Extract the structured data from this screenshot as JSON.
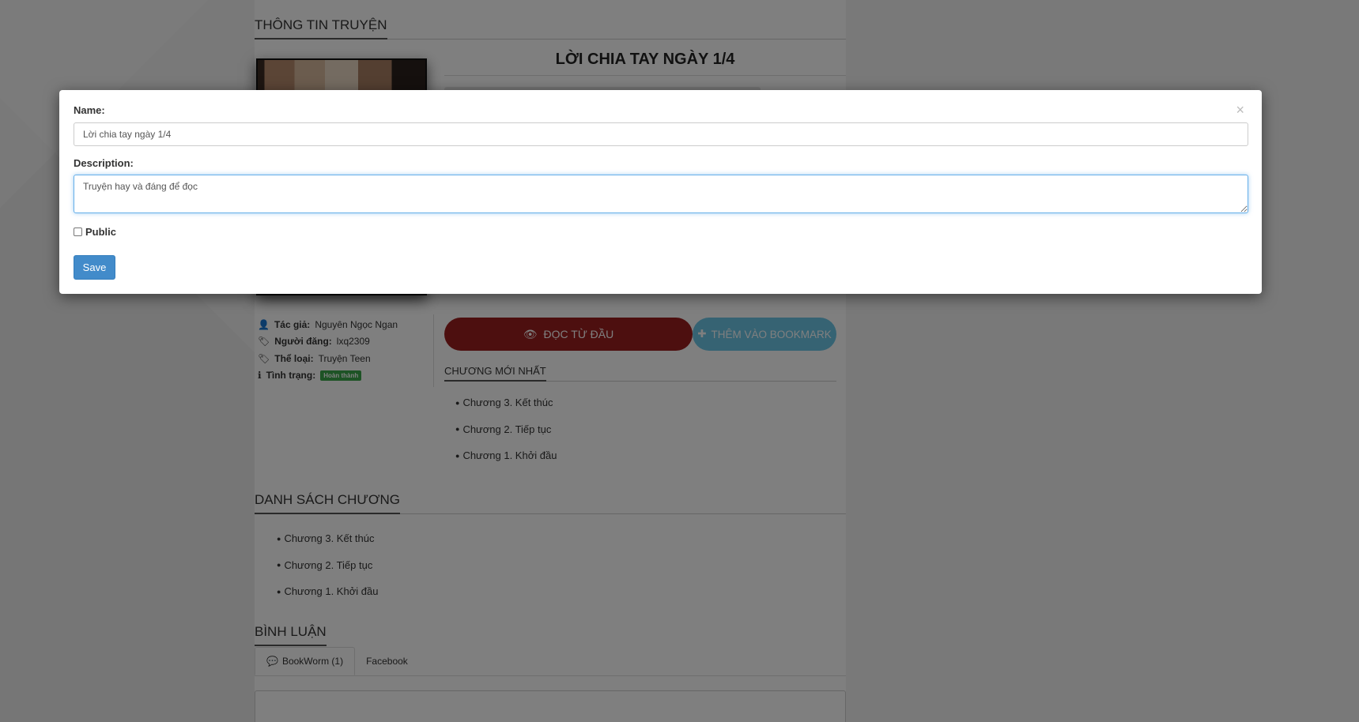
{
  "page": {
    "section_info": "THÔNG TIN TRUYỆN",
    "story_title": "LỜI CHIA TAY NGÀY 1/4",
    "info": [
      {
        "label": "Tác giả:",
        "value": "Nguyên Ngọc Ngan",
        "icon": "user-icon"
      },
      {
        "label": "Người đăng:",
        "value": "lxq2309",
        "icon": "tag-icon"
      },
      {
        "label": "Thể loại:",
        "value": "Truyện Teen",
        "icon": "tag-icon"
      },
      {
        "label": "Tình trạng:",
        "value": "Hoàn thành",
        "icon": "info-icon"
      }
    ],
    "btn_read": "ĐỌC TỪ ĐẦU",
    "btn_bookmark": "THÊM VÀO BOOKMARK",
    "latest_head": "CHƯƠNG MỚI NHẤT",
    "latest_chapters": [
      "Chương 3. Kết thúc",
      "Chương 2. Tiếp tục",
      "Chương 1. Khởi đầu"
    ],
    "section_chapters": "DANH SÁCH CHƯƠNG",
    "chapters": [
      "Chương 3. Kết thúc",
      "Chương 2. Tiếp tục",
      "Chương 1. Khởi đầu"
    ],
    "section_comments": "BÌNH LUẬN",
    "tabs": [
      "BookWorm (1)",
      "Facebook"
    ]
  },
  "modal": {
    "name_label": "Name:",
    "name_value": "Lời chia tay ngày 1/4",
    "description_label": "Description:",
    "description_value": "Truyện hay và đáng để đọc",
    "public_label": "Public",
    "public_checked": false,
    "save_label": "Save",
    "close_symbol": "×"
  },
  "colors": {
    "read_button": "#9b1e1e",
    "bookmark_button": "#6cc6e6",
    "save_button": "#428bca",
    "status_badge": "#3aa64b"
  }
}
